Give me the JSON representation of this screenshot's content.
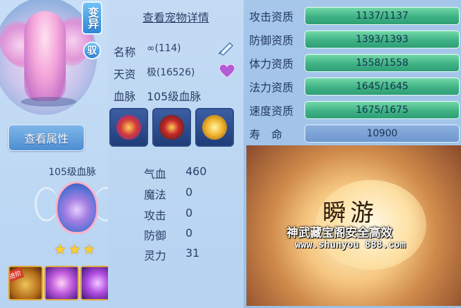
{
  "left": {
    "badge_mutate": "变异",
    "badge_tame": "驭",
    "view_attributes_button": "查看属性",
    "bloodline_title": "105级血脉",
    "stars": [
      "★",
      "★",
      "★"
    ],
    "skill_tag": "进阶"
  },
  "middle": {
    "detail_link": "查看宠物详情",
    "name_label": "名称",
    "name_value": "∞(114)",
    "aptitude_label": "天资",
    "aptitude_value": "极(16526)",
    "bloodline_label": "血脉",
    "bloodline_value": "105级血脉",
    "stats": [
      {
        "label": "气血",
        "value": "460"
      },
      {
        "label": "魔法",
        "value": "0"
      },
      {
        "label": "攻击",
        "value": "0"
      },
      {
        "label": "防御",
        "value": "0"
      },
      {
        "label": "灵力",
        "value": "31"
      }
    ]
  },
  "right": {
    "qualities": [
      {
        "label": "攻击资质",
        "value": "1137/1137"
      },
      {
        "label": "防御资质",
        "value": "1393/1393"
      },
      {
        "label": "体力资质",
        "value": "1558/1558"
      },
      {
        "label": "法力资质",
        "value": "1645/1645"
      },
      {
        "label": "速度资质",
        "value": "1675/1675"
      }
    ],
    "life_label": "寿　命",
    "life_value": "10900",
    "ad": {
      "title": "瞬游",
      "slogan": "神武藏宝阁安全高效",
      "url": "www.shunyou 888.com"
    }
  },
  "colors": {
    "background": "#b9d6f3",
    "quality_bar": "#3fb285",
    "life_bar": "#6e97cf",
    "text": "#2a3f66"
  }
}
